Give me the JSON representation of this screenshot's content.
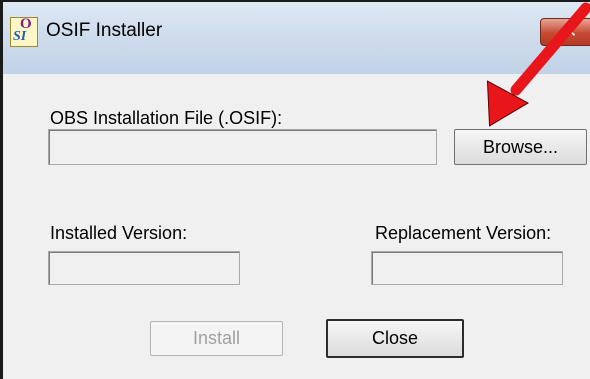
{
  "window": {
    "title": "OSIF Installer",
    "icon_glyph_top": "O",
    "icon_glyph_bottom": "SI",
    "close_glyph": "✕"
  },
  "form": {
    "file_label": "OBS Installation File (.OSIF):",
    "file_value": "",
    "browse_label": "Browse...",
    "installed_label": "Installed Version:",
    "installed_value": "",
    "replacement_label": "Replacement Version:",
    "replacement_value": "",
    "install_label": "Install",
    "close_label": "Close"
  },
  "annotation": {
    "arrow_color": "#e8161a",
    "points_to": "browse-button"
  }
}
